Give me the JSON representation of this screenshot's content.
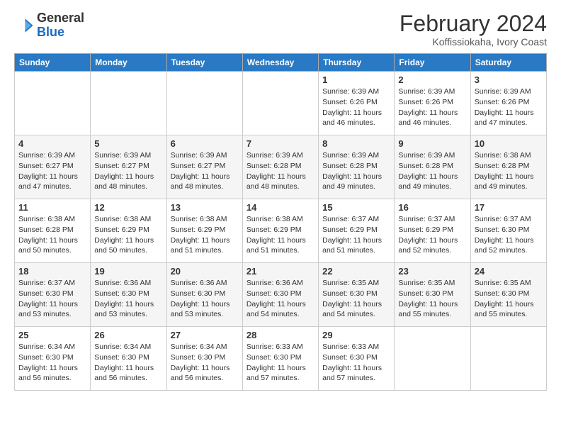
{
  "logo": {
    "general": "General",
    "blue": "Blue"
  },
  "header": {
    "month": "February 2024",
    "location": "Koffissiokaha, Ivory Coast"
  },
  "days_of_week": [
    "Sunday",
    "Monday",
    "Tuesday",
    "Wednesday",
    "Thursday",
    "Friday",
    "Saturday"
  ],
  "weeks": [
    [
      {
        "day": "",
        "info": ""
      },
      {
        "day": "",
        "info": ""
      },
      {
        "day": "",
        "info": ""
      },
      {
        "day": "",
        "info": ""
      },
      {
        "day": "1",
        "info": "Sunrise: 6:39 AM\nSunset: 6:26 PM\nDaylight: 11 hours and 46 minutes."
      },
      {
        "day": "2",
        "info": "Sunrise: 6:39 AM\nSunset: 6:26 PM\nDaylight: 11 hours and 46 minutes."
      },
      {
        "day": "3",
        "info": "Sunrise: 6:39 AM\nSunset: 6:26 PM\nDaylight: 11 hours and 47 minutes."
      }
    ],
    [
      {
        "day": "4",
        "info": "Sunrise: 6:39 AM\nSunset: 6:27 PM\nDaylight: 11 hours and 47 minutes."
      },
      {
        "day": "5",
        "info": "Sunrise: 6:39 AM\nSunset: 6:27 PM\nDaylight: 11 hours and 48 minutes."
      },
      {
        "day": "6",
        "info": "Sunrise: 6:39 AM\nSunset: 6:27 PM\nDaylight: 11 hours and 48 minutes."
      },
      {
        "day": "7",
        "info": "Sunrise: 6:39 AM\nSunset: 6:28 PM\nDaylight: 11 hours and 48 minutes."
      },
      {
        "day": "8",
        "info": "Sunrise: 6:39 AM\nSunset: 6:28 PM\nDaylight: 11 hours and 49 minutes."
      },
      {
        "day": "9",
        "info": "Sunrise: 6:39 AM\nSunset: 6:28 PM\nDaylight: 11 hours and 49 minutes."
      },
      {
        "day": "10",
        "info": "Sunrise: 6:38 AM\nSunset: 6:28 PM\nDaylight: 11 hours and 49 minutes."
      }
    ],
    [
      {
        "day": "11",
        "info": "Sunrise: 6:38 AM\nSunset: 6:28 PM\nDaylight: 11 hours and 50 minutes."
      },
      {
        "day": "12",
        "info": "Sunrise: 6:38 AM\nSunset: 6:29 PM\nDaylight: 11 hours and 50 minutes."
      },
      {
        "day": "13",
        "info": "Sunrise: 6:38 AM\nSunset: 6:29 PM\nDaylight: 11 hours and 51 minutes."
      },
      {
        "day": "14",
        "info": "Sunrise: 6:38 AM\nSunset: 6:29 PM\nDaylight: 11 hours and 51 minutes."
      },
      {
        "day": "15",
        "info": "Sunrise: 6:37 AM\nSunset: 6:29 PM\nDaylight: 11 hours and 51 minutes."
      },
      {
        "day": "16",
        "info": "Sunrise: 6:37 AM\nSunset: 6:29 PM\nDaylight: 11 hours and 52 minutes."
      },
      {
        "day": "17",
        "info": "Sunrise: 6:37 AM\nSunset: 6:30 PM\nDaylight: 11 hours and 52 minutes."
      }
    ],
    [
      {
        "day": "18",
        "info": "Sunrise: 6:37 AM\nSunset: 6:30 PM\nDaylight: 11 hours and 53 minutes."
      },
      {
        "day": "19",
        "info": "Sunrise: 6:36 AM\nSunset: 6:30 PM\nDaylight: 11 hours and 53 minutes."
      },
      {
        "day": "20",
        "info": "Sunrise: 6:36 AM\nSunset: 6:30 PM\nDaylight: 11 hours and 53 minutes."
      },
      {
        "day": "21",
        "info": "Sunrise: 6:36 AM\nSunset: 6:30 PM\nDaylight: 11 hours and 54 minutes."
      },
      {
        "day": "22",
        "info": "Sunrise: 6:35 AM\nSunset: 6:30 PM\nDaylight: 11 hours and 54 minutes."
      },
      {
        "day": "23",
        "info": "Sunrise: 6:35 AM\nSunset: 6:30 PM\nDaylight: 11 hours and 55 minutes."
      },
      {
        "day": "24",
        "info": "Sunrise: 6:35 AM\nSunset: 6:30 PM\nDaylight: 11 hours and 55 minutes."
      }
    ],
    [
      {
        "day": "25",
        "info": "Sunrise: 6:34 AM\nSunset: 6:30 PM\nDaylight: 11 hours and 56 minutes."
      },
      {
        "day": "26",
        "info": "Sunrise: 6:34 AM\nSunset: 6:30 PM\nDaylight: 11 hours and 56 minutes."
      },
      {
        "day": "27",
        "info": "Sunrise: 6:34 AM\nSunset: 6:30 PM\nDaylight: 11 hours and 56 minutes."
      },
      {
        "day": "28",
        "info": "Sunrise: 6:33 AM\nSunset: 6:30 PM\nDaylight: 11 hours and 57 minutes."
      },
      {
        "day": "29",
        "info": "Sunrise: 6:33 AM\nSunset: 6:30 PM\nDaylight: 11 hours and 57 minutes."
      },
      {
        "day": "",
        "info": ""
      },
      {
        "day": "",
        "info": ""
      }
    ]
  ]
}
